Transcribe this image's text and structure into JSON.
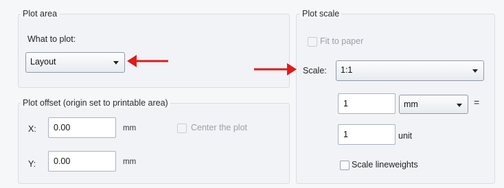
{
  "plot_area": {
    "title": "Plot area",
    "what_to_plot_label": "What to plot:",
    "what_to_plot_value": "Layout"
  },
  "plot_offset": {
    "title": "Plot offset (origin set to printable area)",
    "x_label": "X:",
    "x_value": "0.00",
    "x_unit": "mm",
    "y_label": "Y:",
    "y_value": "0.00",
    "y_unit": "mm",
    "center_label": "Center the plot"
  },
  "plot_scale": {
    "title": "Plot scale",
    "fit_to_paper_label": "Fit to paper",
    "scale_label": "Scale:",
    "scale_value": "1:1",
    "paper_units_value": "1",
    "paper_units_unit": "mm",
    "equals_sign": "=",
    "drawing_units_value": "1",
    "drawing_units_unit": "unit",
    "scale_lineweights_label": "Scale lineweights"
  },
  "annotation_color": "#e11a1a"
}
